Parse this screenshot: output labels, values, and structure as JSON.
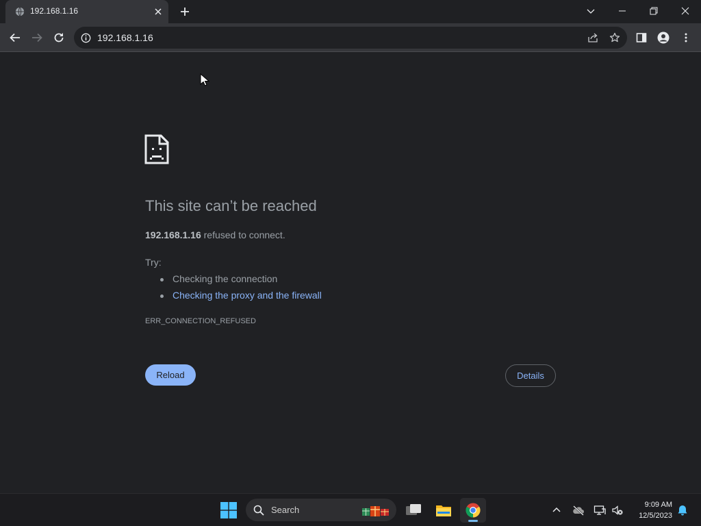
{
  "browser": {
    "tab": {
      "title": "192.168.1.16"
    },
    "address": {
      "url": "192.168.1.16"
    }
  },
  "error_page": {
    "title": "This site can’t be reached",
    "host": "192.168.1.16",
    "message": " refused to connect.",
    "try_label": "Try:",
    "suggestions": [
      {
        "text": "Checking the connection"
      },
      {
        "text": "Checking the proxy and the firewall"
      }
    ],
    "error_code": "ERR_CONNECTION_REFUSED",
    "reload_label": "Reload",
    "details_label": "Details"
  },
  "taskbar": {
    "search_label": "Search",
    "time": "9:09 AM",
    "date": "12/5/2023"
  },
  "colors": {
    "page_bg": "#202124",
    "link": "#8ab4f8",
    "text": "#9aa0a6"
  }
}
